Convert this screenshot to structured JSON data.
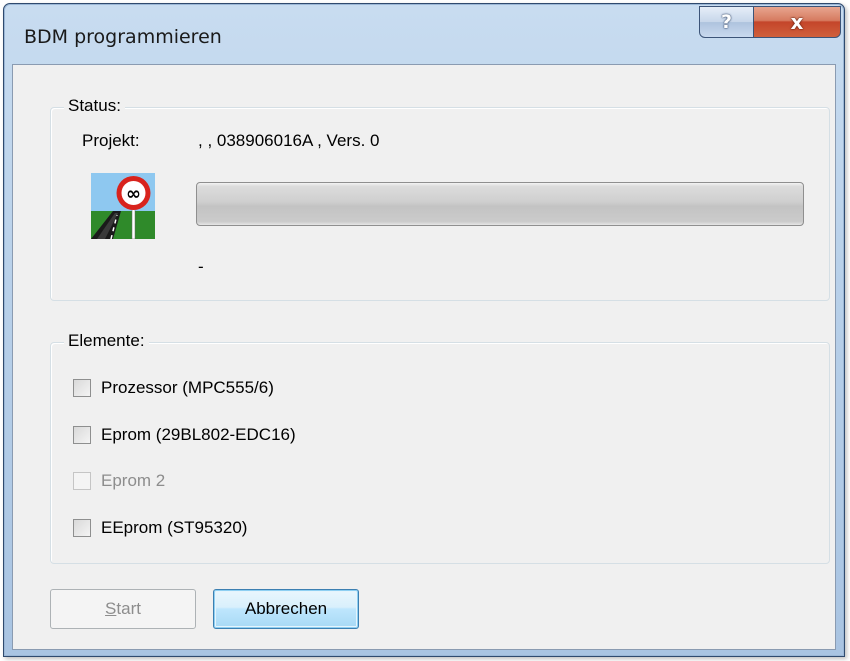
{
  "window": {
    "title": "BDM programmieren"
  },
  "titlebar": {
    "help_label": "?",
    "close_label": "x"
  },
  "status": {
    "group_label": "Status:",
    "projekt_label": "Projekt:",
    "projekt_value": ", , 038906016A , Vers. 0",
    "progress": 0,
    "info_text": "-",
    "icon": "road-infinity-sign-icon"
  },
  "elemente": {
    "group_label": "Elemente:",
    "items": [
      {
        "label": "Prozessor (MPC555/6)",
        "checked": false,
        "enabled": true
      },
      {
        "label": "Eprom (29BL802-EDC16)",
        "checked": false,
        "enabled": true
      },
      {
        "label": "Eprom 2",
        "checked": false,
        "enabled": false
      },
      {
        "label": "EEprom (ST95320)",
        "checked": false,
        "enabled": true
      }
    ]
  },
  "buttons": {
    "start_mnemonic": "S",
    "start_rest": "tart",
    "cancel_label": "Abbrechen"
  },
  "colors": {
    "dialog_bg": "#f0f0f0",
    "close_button": "#c4452a",
    "progress_track": "#cfcfcf",
    "default_button_border": "#3c7fb1"
  }
}
